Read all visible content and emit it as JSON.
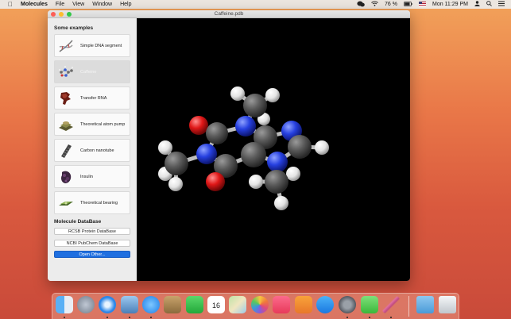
{
  "menubar": {
    "app_name": "Molecules",
    "menus": [
      "File",
      "View",
      "Window",
      "Help"
    ],
    "battery": "76 %",
    "clock": "Mon 11:29 PM"
  },
  "window": {
    "title": "Caffeine.pdb"
  },
  "sidebar": {
    "examples_title": "Some examples",
    "examples": [
      {
        "label": "Simple DNA segment",
        "icon": "dna-icon"
      },
      {
        "label": "Caffeine",
        "icon": "caffeine-icon",
        "selected": true
      },
      {
        "label": "Transfer RNA",
        "icon": "trna-icon"
      },
      {
        "label": "Theoretical atom pump",
        "icon": "atom-pump-icon"
      },
      {
        "label": "Carbon nanotube",
        "icon": "nanotube-icon"
      },
      {
        "label": "Insulin",
        "icon": "insulin-icon"
      },
      {
        "label": "Theoretical bearing",
        "icon": "bearing-icon"
      }
    ],
    "database_title": "Molecule DataBase",
    "rcsb_label": "RCSB Protein DataBase",
    "ncbi_label": "NCBI PubChem DataBase",
    "open_label": "Open Other..."
  },
  "dock": {
    "calendar_day": "16",
    "icons": [
      "finder-icon",
      "launchpad-icon",
      "safari-icon",
      "preview-icon",
      "messages-icon",
      "notes-icon",
      "facetime-icon",
      "calendar-icon",
      "maps-icon",
      "photos-icon",
      "music-icon",
      "books-icon",
      "app-store-icon",
      "system-preferences-icon",
      "wechat-icon",
      "molecules-icon",
      "downloads-folder-icon",
      "trash-icon"
    ]
  }
}
